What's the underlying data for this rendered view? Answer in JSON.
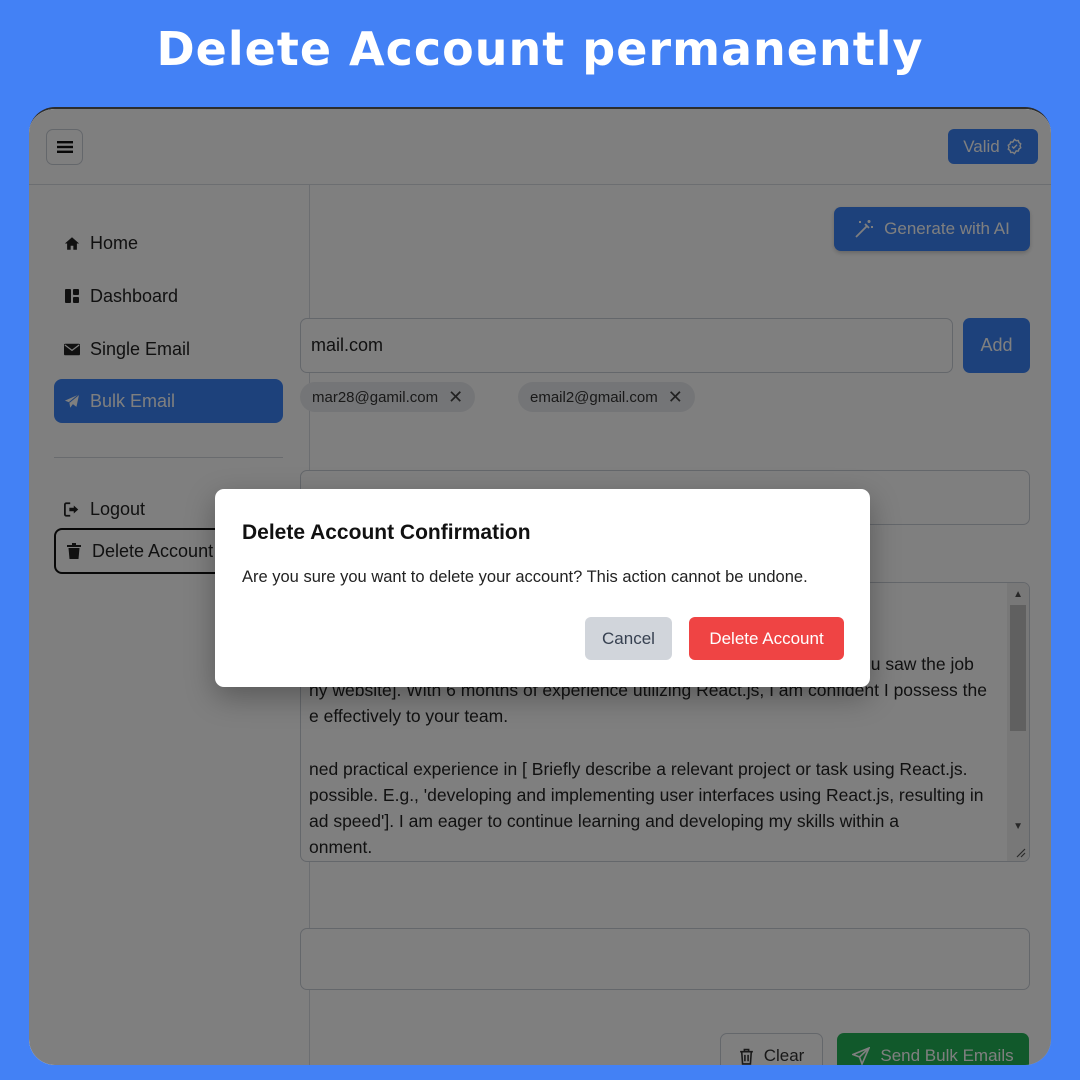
{
  "banner": {
    "title": "Delete Account permanently"
  },
  "header": {
    "valid_label": "Valid"
  },
  "sidebar": {
    "items": [
      {
        "label": "Home",
        "icon": "home-icon"
      },
      {
        "label": "Dashboard",
        "icon": "dashboard-icon"
      },
      {
        "label": "Single Email",
        "icon": "envelope-icon"
      },
      {
        "label": "Bulk Email",
        "icon": "paper-plane-icon",
        "active": true
      }
    ],
    "account": [
      {
        "label": "Logout",
        "icon": "logout-icon"
      },
      {
        "label": "Delete Account",
        "icon": "trash-icon"
      }
    ]
  },
  "main": {
    "generate_label": "Generate with AI",
    "email_value": "mail.com",
    "add_label": "Add",
    "chips": [
      "mar28@gamil.com",
      "email2@gmail.com"
    ],
    "body_lines": [
      "ou saw the job",
      "ny website].  With 6 months of experience utilizing React.js, I am confident I possess the",
      "e effectively to your team.",
      "",
      "ned practical experience in [ Briefly describe a relevant project or task using React.js.",
      "possible. E.g.,  'developing and implementing user interfaces using React.js, resulting in",
      "ad speed'].  I am eager to continue learning and developing my skills within a",
      "onment."
    ],
    "clear_label": "Clear",
    "send_label": "Send Bulk Emails"
  },
  "modal": {
    "title": "Delete Account Confirmation",
    "message": "Are you sure you want to delete your account? This action cannot be undone.",
    "cancel_label": "Cancel",
    "delete_label": "Delete Account"
  },
  "colors": {
    "page_bg": "#4381F5",
    "primary": "#3b82f6",
    "danger": "#ef4444",
    "success": "#22b357",
    "neutral_btn": "#d1d5db"
  }
}
